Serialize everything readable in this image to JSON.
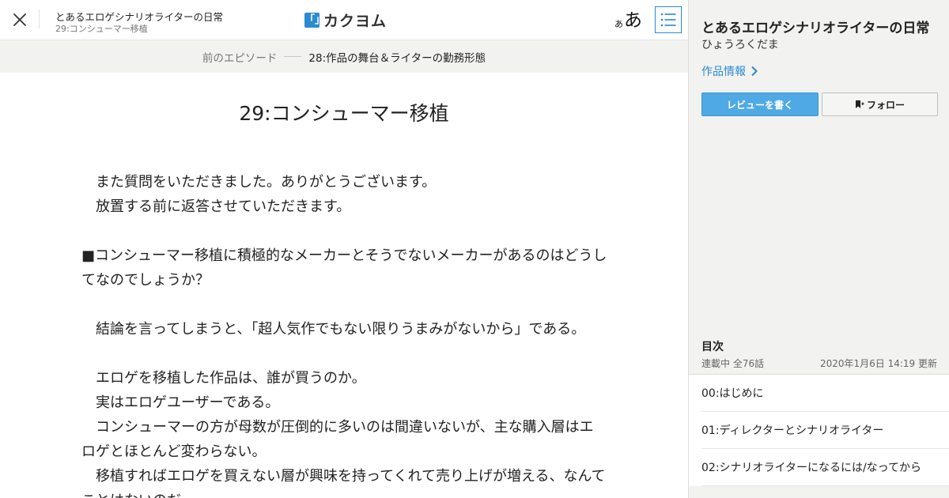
{
  "header": {
    "work_title": "とあるエロゲシナリオライターの日常",
    "episode_title": "29:コンシューマー移植",
    "logo_mark": "「」",
    "logo_text": "カクヨム",
    "font_toggle_small": "あ",
    "font_toggle_large": "あ",
    "close_icon": "close-icon",
    "toc_icon": "list-icon"
  },
  "prev_episode": {
    "label": "前のエピソード",
    "title": "28:作品の舞台＆ライターの勤務形態"
  },
  "episode": {
    "heading": "29:コンシューマー移植",
    "paragraphs": [
      "　また質問をいただきました。ありがとうございます。",
      "　放置する前に返答させていただきます。",
      "",
      "■コンシューマー移植に積極的なメーカーとそうでないメーカーがあるのはどうしてなのでしょうか？",
      "",
      "　結論を言ってしまうと、「超人気作でもない限りうまみがないから」である。",
      "",
      "　エロゲを移植した作品は、誰が買うのか。",
      "　実はエロゲユーザーである。",
      "　コンシューマーの方が母数が圧倒的に多いのは間違いないが、主な購入層はエロゲとほとんど変わらない。",
      "　移植すればエロゲを買えない層が興味を持ってくれて売り上げが増える、なんてことはないのだ。"
    ]
  },
  "sidebar": {
    "work_title": "とあるエロゲシナリオライターの日常",
    "author": "ひょうろくだま",
    "work_info_label": "作品情報",
    "review_button": "レビューを書く",
    "follow_button": "フォロー",
    "toc_heading": "目次",
    "toc_status": "連載中 全76話",
    "toc_updated": "2020年1月6日 14:19 更新",
    "toc_items": [
      "00:はじめに",
      "01:ディレクターとシナリオライター",
      "02:シナリオライターになるには/なってから"
    ]
  },
  "colors": {
    "accent": "#2b8ad1",
    "review_button_bg": "#4fa9e4",
    "sidebar_bg": "#f2f2f0"
  }
}
